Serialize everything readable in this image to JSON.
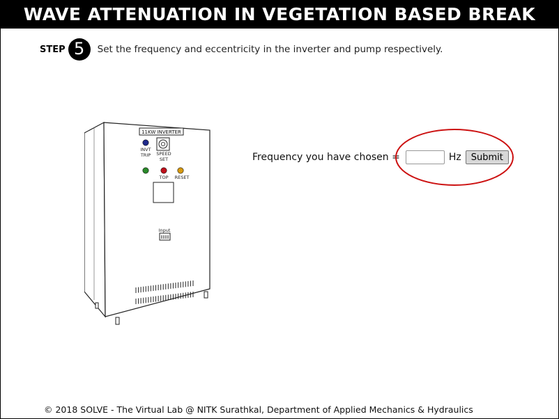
{
  "header": {
    "title": "WAVE ATTENUATION IN VEGETATION BASED BREAK"
  },
  "step": {
    "label": "STEP",
    "number": "5",
    "instruction": "Set the frequency and eccentricity in the inverter and pump respectively."
  },
  "inverter": {
    "panel_label": "11KW INVERTER",
    "invt_trip_line1": "INVT",
    "invt_trip_line2": "TRIP",
    "speed_set_line1": "SPEED",
    "speed_set_line2": "SET",
    "top_label": "TOP",
    "reset_label": "RESET",
    "input_label": "Input",
    "colors": {
      "trip": "#1f2a8c",
      "green": "#2a8a2a",
      "red": "#c0101a",
      "amber": "#d89a10"
    }
  },
  "frequency_form": {
    "label": "Frequency you have chosen =",
    "value": "",
    "placeholder": "",
    "unit": "Hz",
    "submit_label": "Submit",
    "highlight_color": "#cc1111"
  },
  "footer": {
    "text": "© 2018 SOLVE - The Virtual Lab @ NITK Surathkal, Department of Applied Mechanics & Hydraulics"
  }
}
